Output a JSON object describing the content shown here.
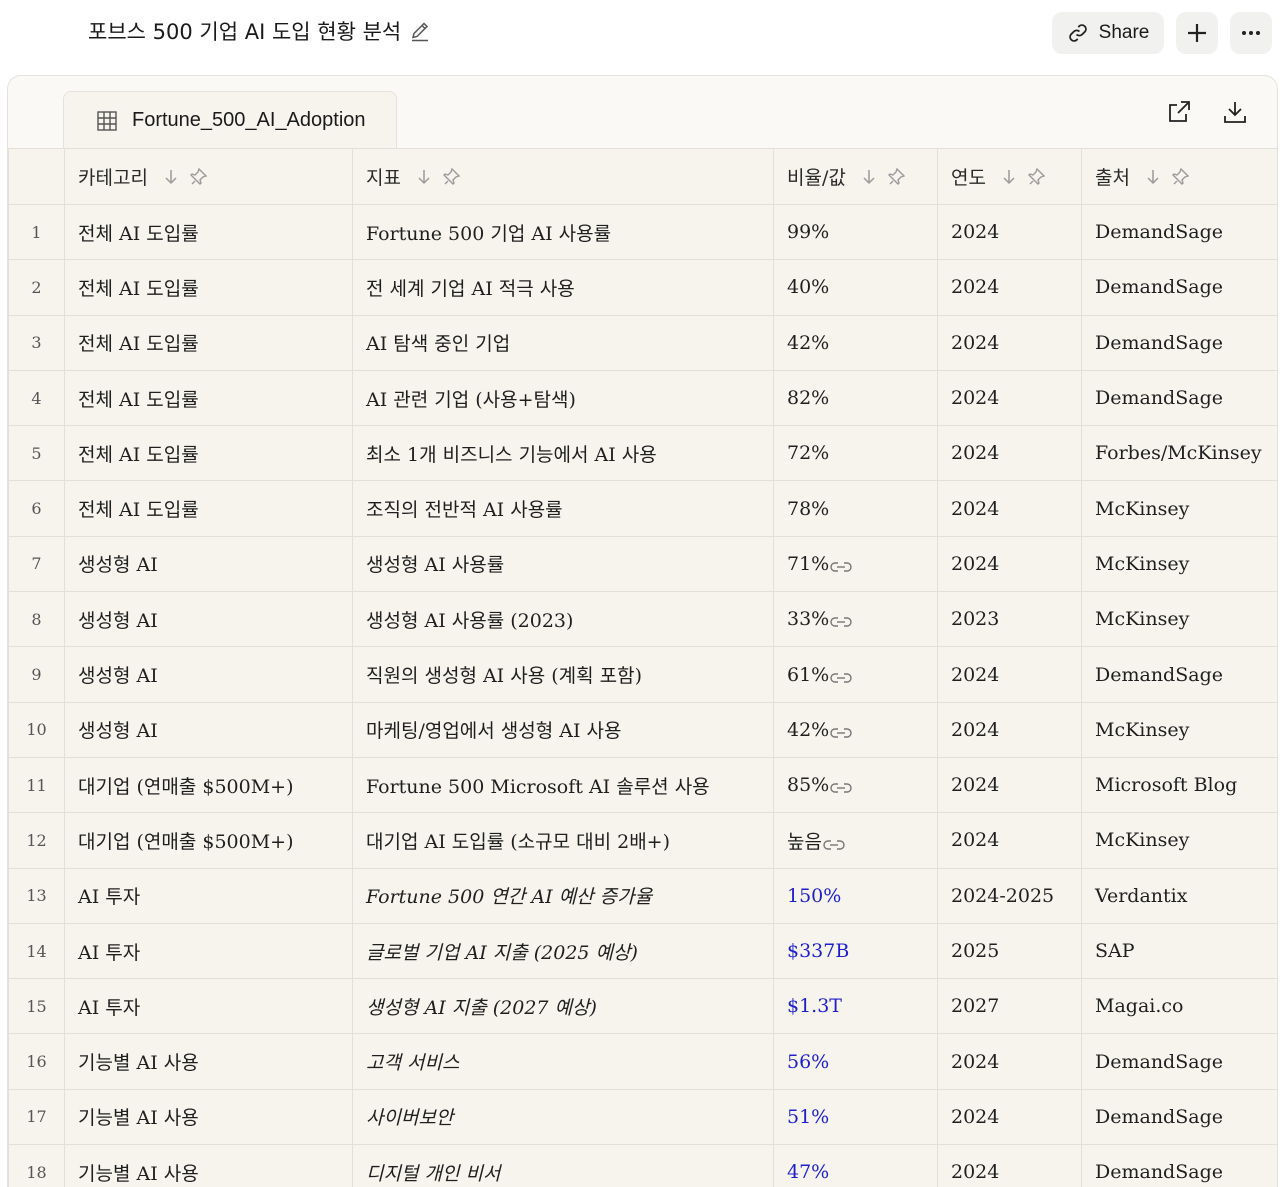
{
  "header": {
    "title": "포브스 500 기업 AI 도입 현황 분석",
    "share_label": "Share"
  },
  "panel": {
    "tab_label": "Fortune_500_AI_Adoption"
  },
  "table": {
    "columns": [
      "카테고리",
      "지표",
      "비율/값",
      "연도",
      "출처"
    ],
    "rows": [
      {
        "num": "1",
        "category": "전체 AI 도입률",
        "metric": "Fortune 500 기업 AI 사용률",
        "value": "99%",
        "year": "2024",
        "source": "DemandSage"
      },
      {
        "num": "2",
        "category": "전체 AI 도입률",
        "metric": "전 세계 기업 AI 적극 사용",
        "value": "40%",
        "year": "2024",
        "source": "DemandSage"
      },
      {
        "num": "3",
        "category": "전체 AI 도입률",
        "metric": "AI 탐색 중인 기업",
        "value": "42%",
        "year": "2024",
        "source": "DemandSage"
      },
      {
        "num": "4",
        "category": "전체 AI 도입률",
        "metric": "AI 관련 기업 (사용+탐색)",
        "value": "82%",
        "year": "2024",
        "source": "DemandSage"
      },
      {
        "num": "5",
        "category": "전체 AI 도입률",
        "metric": "최소 1개 비즈니스 기능에서 AI 사용",
        "value": "72%",
        "year": "2024",
        "source": "Forbes/McKinsey"
      },
      {
        "num": "6",
        "category": "전체 AI 도입률",
        "metric": "조직의 전반적 AI 사용률",
        "value": "78%",
        "year": "2024",
        "source": "McKinsey"
      },
      {
        "num": "7",
        "category": "생성형 AI",
        "metric": "생성형 AI 사용률",
        "value": "71%",
        "year": "2024",
        "source": "McKinsey"
      },
      {
        "num": "8",
        "category": "생성형 AI",
        "metric": "생성형 AI 사용률 (2023)",
        "value": "33%",
        "year": "2023",
        "source": "McKinsey"
      },
      {
        "num": "9",
        "category": "생성형 AI",
        "metric": "직원의 생성형 AI 사용 (계획 포함)",
        "value": "61%",
        "year": "2024",
        "source": "DemandSage"
      },
      {
        "num": "10",
        "category": "생성형 AI",
        "metric": "마케팅/영업에서 생성형 AI 사용",
        "value": "42%",
        "year": "2024",
        "source": "McKinsey"
      },
      {
        "num": "11",
        "category": "대기업 (연매출 $500M+)",
        "metric": "Fortune 500 Microsoft AI 솔루션 사용",
        "value": "85%",
        "year": "2024",
        "source": "Microsoft Blog"
      },
      {
        "num": "12",
        "category": "대기업 (연매출 $500M+)",
        "metric": "대기업 AI 도입률 (소규모 대비 2배+)",
        "value": "높음",
        "year": "2024",
        "source": "McKinsey"
      },
      {
        "num": "13",
        "category": "AI 투자",
        "metric": "Fortune 500 연간 AI 예산 증가율",
        "value": "150%",
        "year": "2024-2025",
        "source": "Verdantix"
      },
      {
        "num": "14",
        "category": "AI 투자",
        "metric": "글로벌 기업 AI 지출 (2025 예상)",
        "value": "$337B",
        "year": "2025",
        "source": "SAP"
      },
      {
        "num": "15",
        "category": "AI 투자",
        "metric": "생성형 AI 지출 (2027 예상)",
        "value": "$1.3T",
        "year": "2027",
        "source": "Magai.co"
      },
      {
        "num": "16",
        "category": "기능별 AI 사용",
        "metric": "고객 서비스",
        "value": "56%",
        "year": "2024",
        "source": "DemandSage"
      },
      {
        "num": "17",
        "category": "기능별 AI 사용",
        "metric": "사이버보안",
        "value": "51%",
        "year": "2024",
        "source": "DemandSage"
      },
      {
        "num": "18",
        "category": "기능별 AI 사용",
        "metric": "디지털 개인 비서",
        "value": "47%",
        "year": "2024",
        "source": "DemandSage"
      }
    ]
  },
  "style": {
    "link_rows": [
      "7",
      "8",
      "9",
      "10",
      "11",
      "12"
    ],
    "italic_blue_rows": [
      "13",
      "14",
      "15",
      "16",
      "17",
      "18"
    ],
    "blue_value_color": "#1f1fd0"
  }
}
